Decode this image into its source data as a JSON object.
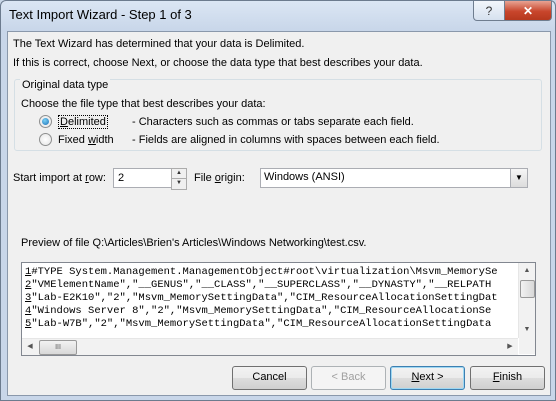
{
  "window": {
    "title": "Text Import Wizard - Step 1 of 3",
    "help_glyph": "?",
    "close_glyph": "✕"
  },
  "intro": {
    "line1": "The Text Wizard has determined that your data is Delimited.",
    "line2": "If this is correct, choose Next, or choose the data type that best describes your data."
  },
  "original_type": {
    "legend": "Original data type",
    "prompt": "Choose the file type that best describes your data:",
    "options": [
      {
        "label_pre": "",
        "label_key": "D",
        "label_post": "elimited",
        "desc": "- Characters such as commas or tabs separate each field.",
        "checked": true
      },
      {
        "label_pre": "Fixed ",
        "label_key": "w",
        "label_post": "idth",
        "desc": "- Fields are aligned in columns with spaces between each field.",
        "checked": false
      }
    ]
  },
  "start_row": {
    "label_pre": "Start import at ",
    "label_key": "r",
    "label_post": "ow:",
    "value": "2"
  },
  "file_origin": {
    "label_pre": "File ",
    "label_key": "o",
    "label_post": "rigin:",
    "value": "Windows (ANSI)"
  },
  "preview": {
    "label": "Preview of file Q:\\Articles\\Brien's Articles\\Windows Networking\\test.csv.",
    "rows": [
      {
        "num": "1",
        "text": "#TYPE System.Management.ManagementObject#root\\virtualization\\Msvm_MemorySe"
      },
      {
        "num": "2",
        "text": "\"VMElementName\",\"__GENUS\",\"__CLASS\",\"__SUPERCLASS\",\"__DYNASTY\",\"__RELPATH"
      },
      {
        "num": "3",
        "text": "\"Lab-E2K10\",\"2\",\"Msvm_MemorySettingData\",\"CIM_ResourceAllocationSettingDat"
      },
      {
        "num": "4",
        "text": "\"Windows Server 8\",\"2\",\"Msvm_MemorySettingData\",\"CIM_ResourceAllocationSe"
      },
      {
        "num": "5",
        "text": "\"Lab-W7B\",\"2\",\"Msvm_MemorySettingData\",\"CIM_ResourceAllocationSettingData"
      }
    ],
    "hthumb_glyph": "III"
  },
  "buttons": {
    "cancel": "Cancel",
    "back": "< Back",
    "next": "Next >",
    "finish": "Finish"
  }
}
